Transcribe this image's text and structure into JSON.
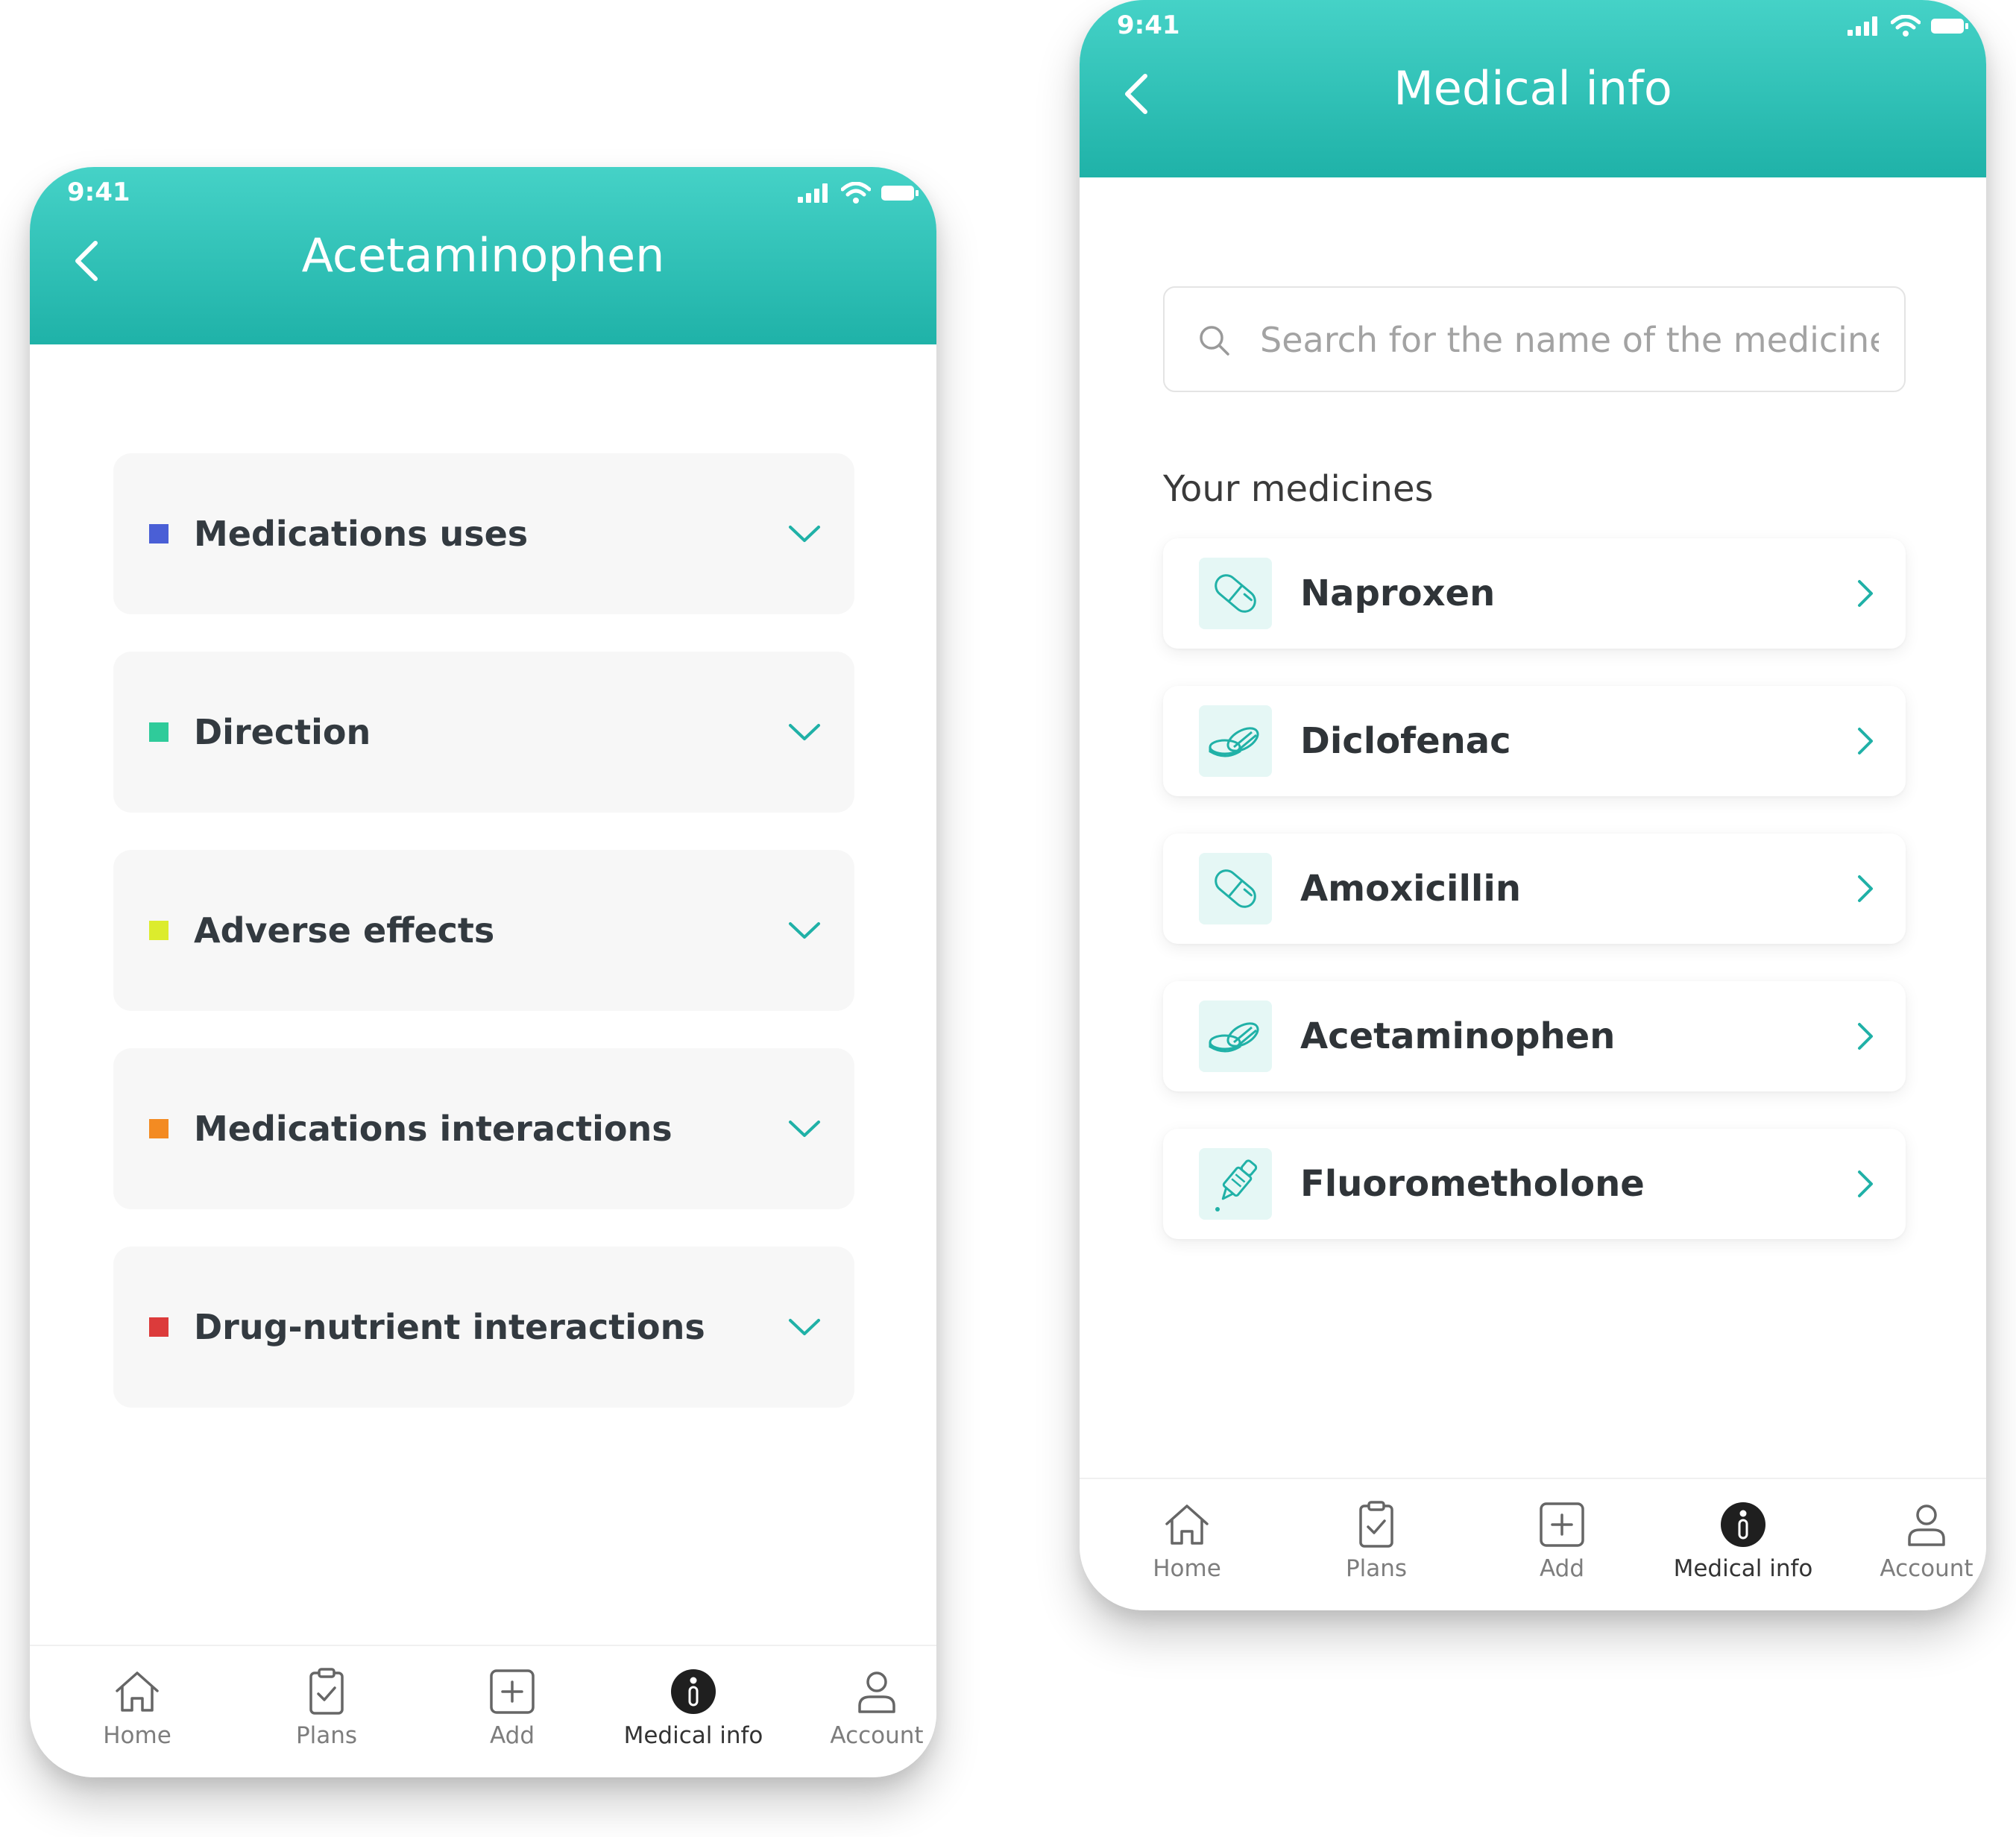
{
  "colors": {
    "header_top": "#45d2c7",
    "header_bottom": "#1fb2a8",
    "accent": "#20b1a7",
    "card_bg": "#f7f7f7",
    "thumb_bg": "#e5f7f5"
  },
  "status_bar": {
    "time": "9:41",
    "icons": [
      "signal-icon",
      "wifi-icon",
      "battery-icon"
    ]
  },
  "left_screen": {
    "title": "Acetaminophen",
    "sections": [
      {
        "label": "Medications uses",
        "color": "#4a5fd6"
      },
      {
        "label": "Direction",
        "color": "#2fcb9a"
      },
      {
        "label": "Adverse effects",
        "color": "#dcec2d"
      },
      {
        "label": "Medications interactions",
        "color": "#f38b22"
      },
      {
        "label": "Drug-nutrient interactions",
        "color": "#dc3b3b"
      }
    ]
  },
  "right_screen": {
    "title": "Medical info",
    "search": {
      "placeholder": "Search for the name of the medicine",
      "value": ""
    },
    "section_title": "Your medicines",
    "medicines": [
      {
        "name": "Naproxen",
        "icon": "capsule-icon"
      },
      {
        "name": "Diclofenac",
        "icon": "tablets-icon"
      },
      {
        "name": "Amoxicillin",
        "icon": "capsule-icon"
      },
      {
        "name": "Acetaminophen",
        "icon": "tablets-icon"
      },
      {
        "name": "Fluorometholone",
        "icon": "dropper-icon"
      }
    ]
  },
  "bottom_nav": {
    "active": "Medical info",
    "items": [
      {
        "label": "Home",
        "icon": "home-icon"
      },
      {
        "label": "Plans",
        "icon": "clipboard-icon"
      },
      {
        "label": "Add",
        "icon": "add-icon"
      },
      {
        "label": "Medical info",
        "icon": "info-icon"
      },
      {
        "label": "Account",
        "icon": "user-icon"
      }
    ]
  }
}
